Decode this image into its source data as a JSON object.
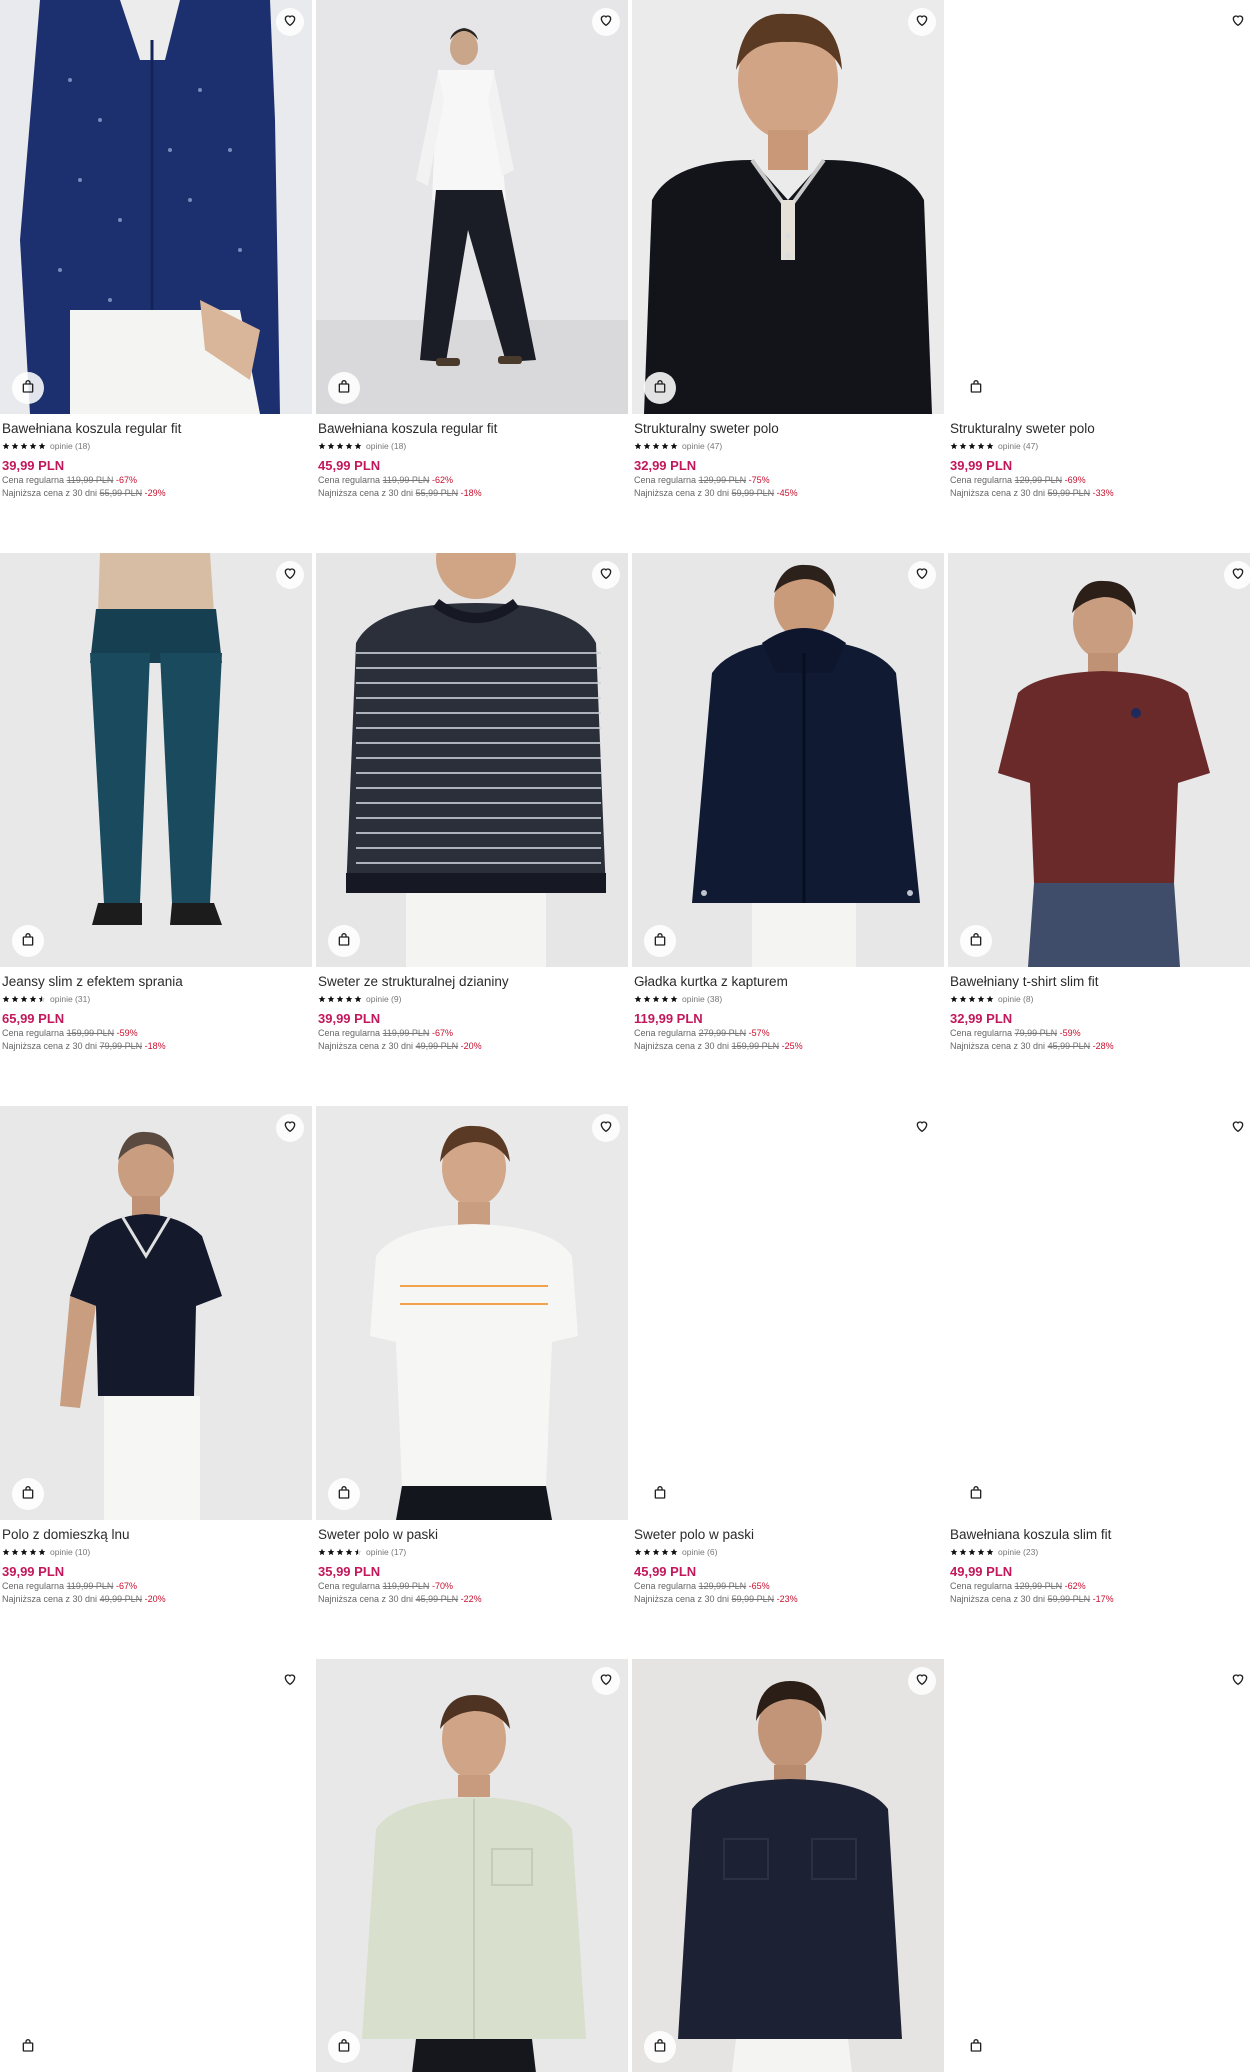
{
  "products": [
    {
      "name": "Bawełniana koszula regular fit",
      "stars": 5,
      "reviews": "opinie (18)",
      "price": "39,99 PLN",
      "regular_label": "Cena regularna",
      "regular_price": "119,99 PLN",
      "regular_discount": "-67%",
      "lowest_label": "Najniższa cena z 30 dni",
      "lowest_price": "55,99 PLN",
      "lowest_discount": "-29%"
    },
    {
      "name": "Bawełniana koszula regular fit",
      "stars": 5,
      "reviews": "opinie (18)",
      "price": "45,99 PLN",
      "regular_label": "Cena regularna",
      "regular_price": "119,99 PLN",
      "regular_discount": "-62%",
      "lowest_label": "Najniższa cena z 30 dni",
      "lowest_price": "55,99 PLN",
      "lowest_discount": "-18%"
    },
    {
      "name": "Strukturalny sweter polo",
      "stars": 5,
      "reviews": "opinie (47)",
      "price": "32,99 PLN",
      "regular_label": "Cena regularna",
      "regular_price": "129,99 PLN",
      "regular_discount": "-75%",
      "lowest_label": "Najniższa cena z 30 dni",
      "lowest_price": "59,99 PLN",
      "lowest_discount": "-45%"
    },
    {
      "name": "Strukturalny sweter polo",
      "stars": 5,
      "reviews": "opinie (47)",
      "price": "39,99 PLN",
      "regular_label": "Cena regularna",
      "regular_price": "129,99 PLN",
      "regular_discount": "-69%",
      "lowest_label": "Najniższa cena z 30 dni",
      "lowest_price": "59,99 PLN",
      "lowest_discount": "-33%"
    },
    {
      "name": "Jeansy slim z efektem sprania",
      "stars": 4.5,
      "reviews": "opinie (31)",
      "price": "65,99 PLN",
      "regular_label": "Cena regularna",
      "regular_price": "159,99 PLN",
      "regular_discount": "-59%",
      "lowest_label": "Najniższa cena z 30 dni",
      "lowest_price": "79,99 PLN",
      "lowest_discount": "-18%"
    },
    {
      "name": "Sweter ze strukturalnej dzianiny",
      "stars": 5,
      "reviews": "opinie (9)",
      "price": "39,99 PLN",
      "regular_label": "Cena regularna",
      "regular_price": "119,99 PLN",
      "regular_discount": "-67%",
      "lowest_label": "Najniższa cena z 30 dni",
      "lowest_price": "49,99 PLN",
      "lowest_discount": "-20%"
    },
    {
      "name": "Gładka kurtka z kapturem",
      "stars": 5,
      "reviews": "opinie (38)",
      "price": "119,99 PLN",
      "regular_label": "Cena regularna",
      "regular_price": "279,99 PLN",
      "regular_discount": "-57%",
      "lowest_label": "Najniższa cena z 30 dni",
      "lowest_price": "159,99 PLN",
      "lowest_discount": "-25%"
    },
    {
      "name": "Bawełniany t-shirt slim fit",
      "stars": 5,
      "reviews": "opinie (8)",
      "price": "32,99 PLN",
      "regular_label": "Cena regularna",
      "regular_price": "79,99 PLN",
      "regular_discount": "-59%",
      "lowest_label": "Najniższa cena z 30 dni",
      "lowest_price": "45,99 PLN",
      "lowest_discount": "-28%"
    },
    {
      "name": "Polo z domieszką lnu",
      "stars": 5,
      "reviews": "opinie (10)",
      "price": "39,99 PLN",
      "regular_label": "Cena regularna",
      "regular_price": "119,99 PLN",
      "regular_discount": "-67%",
      "lowest_label": "Najniższa cena z 30 dni",
      "lowest_price": "49,99 PLN",
      "lowest_discount": "-20%"
    },
    {
      "name": "Sweter polo w paski",
      "stars": 4.5,
      "reviews": "opinie (17)",
      "price": "35,99 PLN",
      "regular_label": "Cena regularna",
      "regular_price": "119,99 PLN",
      "regular_discount": "-70%",
      "lowest_label": "Najniższa cena z 30 dni",
      "lowest_price": "45,99 PLN",
      "lowest_discount": "-22%"
    },
    {
      "name": "Sweter polo w paski",
      "stars": 5,
      "reviews": "opinie (6)",
      "price": "45,99 PLN",
      "regular_label": "Cena regularna",
      "regular_price": "129,99 PLN",
      "regular_discount": "-65%",
      "lowest_label": "Najniższa cena z 30 dni",
      "lowest_price": "59,99 PLN",
      "lowest_discount": "-23%"
    },
    {
      "name": "Bawełniana koszula slim fit",
      "stars": 5,
      "reviews": "opinie (23)",
      "price": "49,99 PLN",
      "regular_label": "Cena regularna",
      "regular_price": "129,99 PLN",
      "regular_discount": "-62%",
      "lowest_label": "Najniższa cena z 30 dni",
      "lowest_price": "59,99 PLN",
      "lowest_discount": "-17%"
    }
  ],
  "icons": {
    "favorite": "heart-icon",
    "cart": "shopping-bag-icon",
    "rating": "star-icon"
  },
  "colors": {
    "price": "#c2185b",
    "discount": "#c8102e"
  }
}
